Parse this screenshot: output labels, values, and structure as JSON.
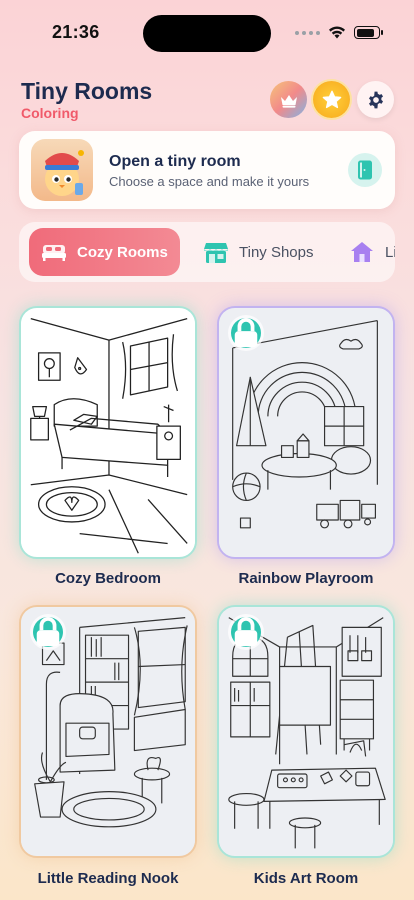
{
  "status_bar": {
    "time": "21:36",
    "battery_level": 0.85
  },
  "header": {
    "title": "Tiny Rooms",
    "subtitle": "Coloring",
    "icons": [
      "crown-icon",
      "star-icon",
      "gear-icon"
    ]
  },
  "promo": {
    "title": "Open a tiny room",
    "subtitle": "Choose a space and make it yours",
    "action_icon": "door-icon"
  },
  "tabs": [
    {
      "label": "Cozy Rooms",
      "icon": "bed-icon",
      "active": true
    },
    {
      "label": "Tiny Shops",
      "icon": "shop-icon",
      "active": false
    },
    {
      "label": "Li",
      "icon": "house-icon",
      "active": false
    }
  ],
  "rooms": [
    {
      "name": "Cozy Bedroom",
      "locked": false
    },
    {
      "name": "Rainbow Playroom",
      "locked": true
    },
    {
      "name": "Little Reading Nook",
      "locked": true
    },
    {
      "name": "Kids Art Room",
      "locked": true
    }
  ],
  "colors": {
    "accent": "#f06b7a",
    "title": "#1d2b4f",
    "lock": "#2ec4b0"
  }
}
